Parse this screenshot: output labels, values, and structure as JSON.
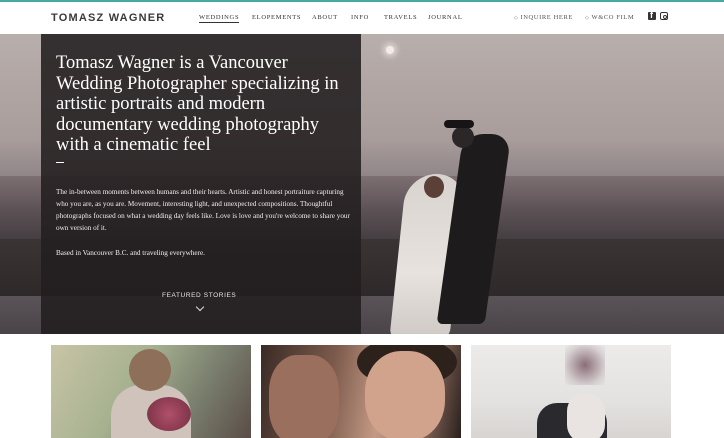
{
  "brand": {
    "logo": "TOMASZ WAGNER",
    "accent": "#4aa7a3"
  },
  "nav": {
    "items": [
      {
        "label": "WEDDINGS",
        "active": true
      },
      {
        "label": "ELOPEMENTS",
        "active": false
      },
      {
        "label": "ABOUT",
        "active": false
      },
      {
        "label": "INFO",
        "active": false
      },
      {
        "label": "TRAVELS",
        "active": false
      },
      {
        "label": "JOURNAL",
        "active": false
      }
    ],
    "aux": [
      {
        "label": "INQUIRE HERE",
        "icon": "diamond-icon"
      },
      {
        "label": "W&CO FILM",
        "icon": "diamond-icon"
      }
    ],
    "social": [
      "facebook-icon",
      "instagram-icon"
    ]
  },
  "hero": {
    "title": "Tomasz Wagner is a Vancouver Wedding Photographer specializing in artistic portraits and modern documentary wedding photography with a cinematic feel",
    "body": "The in-between moments between humans and their hearts. Artistic and honest portraiture capturing who you are, as you are. Movement, interesting light, and unexpected compositions. Thoughtful photographs focused on what a wedding day feels like. Love is love and you're welcome to share your own version of it.",
    "based": "Based in Vancouver B.C. and traveling everywhere.",
    "featured_label": "FEATURED STORIES"
  }
}
